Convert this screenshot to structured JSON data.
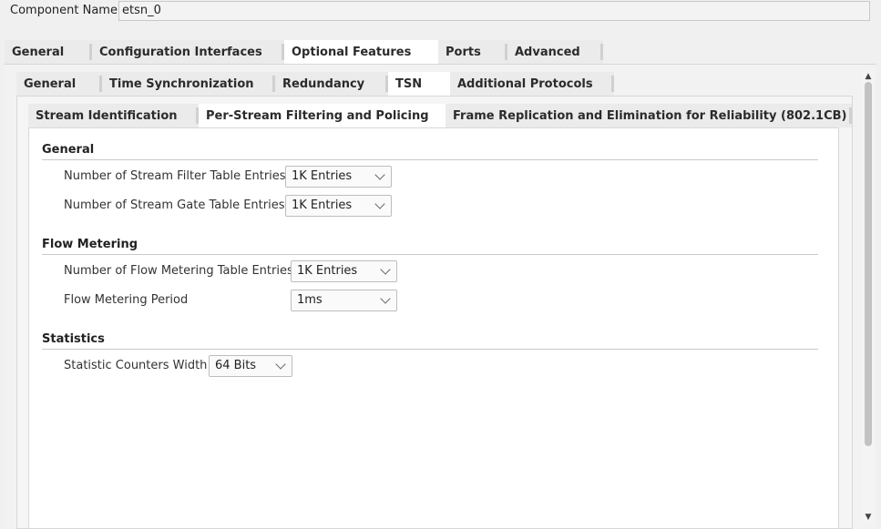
{
  "component": {
    "label": "Component Name",
    "value": "etsn_0"
  },
  "tabs_level1": [
    "General",
    "Configuration Interfaces",
    "Optional Features",
    "Ports",
    "Advanced"
  ],
  "tabs_level2": [
    "General",
    "Time Synchronization",
    "Redundancy",
    "TSN",
    "Additional Protocols"
  ],
  "tabs_level3": [
    "Stream Identification",
    "Per-Stream Filtering and Policing",
    "Frame Replication and Elimination for Reliability (802.1CB)"
  ],
  "active": {
    "level1": "Optional Features",
    "level2": "TSN",
    "level3": "Per-Stream Filtering and Policing"
  },
  "sections": {
    "general": {
      "title": "General",
      "filter_entries_label": "Number of Stream Filter Table Entries",
      "filter_entries_value": "1K Entries",
      "gate_entries_label": "Number of Stream Gate Table Entries",
      "gate_entries_value": "1K Entries"
    },
    "flow_metering": {
      "title": "Flow Metering",
      "table_entries_label": "Number of Flow Metering Table Entries",
      "table_entries_value": "1K Entries",
      "period_label": "Flow Metering Period",
      "period_value": "1ms"
    },
    "statistics": {
      "title": "Statistics",
      "counter_width_label": "Statistic Counters Width",
      "counter_width_value": "64 Bits"
    }
  }
}
